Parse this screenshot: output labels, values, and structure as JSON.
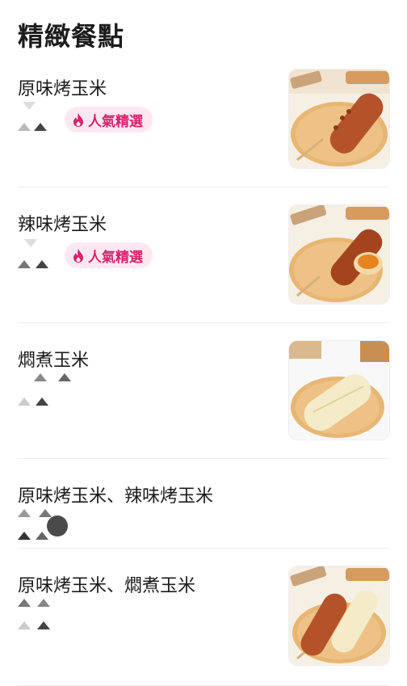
{
  "section": {
    "title": "精緻餐點"
  },
  "items": [
    {
      "name": "原味烤玉米",
      "badge": "人氣精選",
      "image": "grilled-corn-original-photo"
    },
    {
      "name": "辣味烤玉米",
      "badge": "人氣精選",
      "image": "grilled-corn-spicy-photo"
    },
    {
      "name": "燜煮玉米",
      "badge": "",
      "image": "steamed-corn-photo"
    },
    {
      "name": "原味烤玉米、辣味烤玉米",
      "badge": "",
      "image": ""
    },
    {
      "name": "原味烤玉米、燜煮玉米",
      "badge": "",
      "image": "grilled-and-steamed-corn-photo"
    }
  ],
  "colors": {
    "badge_bg": "#fde8f1",
    "badge_text": "#d6246e",
    "divider": "#ececec"
  }
}
